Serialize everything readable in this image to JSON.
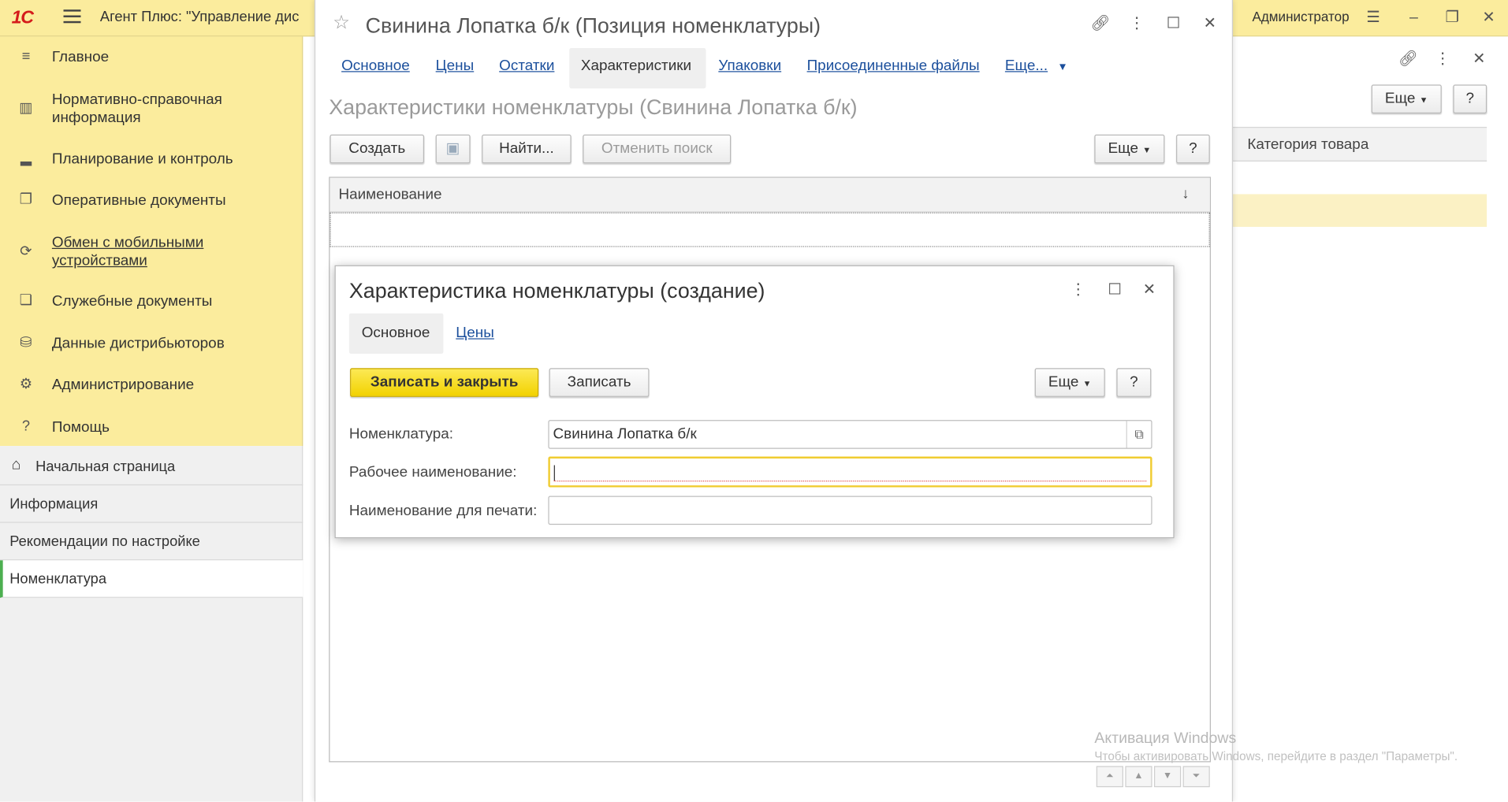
{
  "app": {
    "logo": "1С",
    "title": "Агент Плюс: \"Управление дис",
    "user": "Администратор"
  },
  "sidebar": {
    "items": [
      {
        "label": "Главное",
        "icon": "list-icon"
      },
      {
        "label": "Нормативно-справочная информация",
        "icon": "catalog-icon"
      },
      {
        "label": "Планирование и контроль",
        "icon": "chart-icon"
      },
      {
        "label": "Оперативные документы",
        "icon": "documents-icon"
      },
      {
        "label": "Обмен с мобильными устройствами",
        "icon": "sync-icon"
      },
      {
        "label": "Служебные документы",
        "icon": "service-docs-icon"
      },
      {
        "label": "Данные дистрибьюторов",
        "icon": "distributors-icon"
      },
      {
        "label": "Администрирование",
        "icon": "gear-icon"
      },
      {
        "label": "Помощь",
        "icon": "help-icon"
      }
    ],
    "open_pages": [
      "Начальная страница",
      "Информация",
      "Рекомендации по настройке",
      "Номенклатура"
    ]
  },
  "background_window": {
    "more_label": "Еще",
    "help_label": "?",
    "column_header": "Категория товара"
  },
  "main_window": {
    "title": "Свинина Лопатка б/к (Позиция номенклатуры)",
    "tabs": [
      "Основное",
      "Цены",
      "Остатки",
      "Характеристики",
      "Упаковки",
      "Присоединенные файлы",
      "Еще..."
    ],
    "active_tab": "Характеристики",
    "subtitle": "Характеристики номенклатуры (Свинина Лопатка б/к)",
    "toolbar": {
      "create": "Создать",
      "find": "Найти...",
      "cancel_search": "Отменить поиск",
      "more": "Еще",
      "help": "?"
    },
    "grid": {
      "column": "Наименование",
      "sort_indicator": "↓"
    }
  },
  "dialog": {
    "title": "Характеристика номенклатуры (создание)",
    "tabs": [
      "Основное",
      "Цены"
    ],
    "active_tab": "Основное",
    "buttons": {
      "save_close": "Записать и закрыть",
      "save": "Записать",
      "more": "Еще",
      "help": "?"
    },
    "fields": [
      {
        "label": "Номенклатура:",
        "value": "Свинина Лопатка б/к"
      },
      {
        "label": "Рабочее наименование:",
        "value": ""
      },
      {
        "label": "Наименование для печати:",
        "value": ""
      }
    ]
  },
  "watermark": {
    "line1": "Активация Windows",
    "line2": "Чтобы активировать Windows, перейдите в раздел \"Параметры\"."
  },
  "colors": {
    "sidebar_bg": "#fbec9d",
    "primary_button": "#f2d200",
    "link": "#1b4f9c",
    "focus_border": "#f0cc32"
  }
}
